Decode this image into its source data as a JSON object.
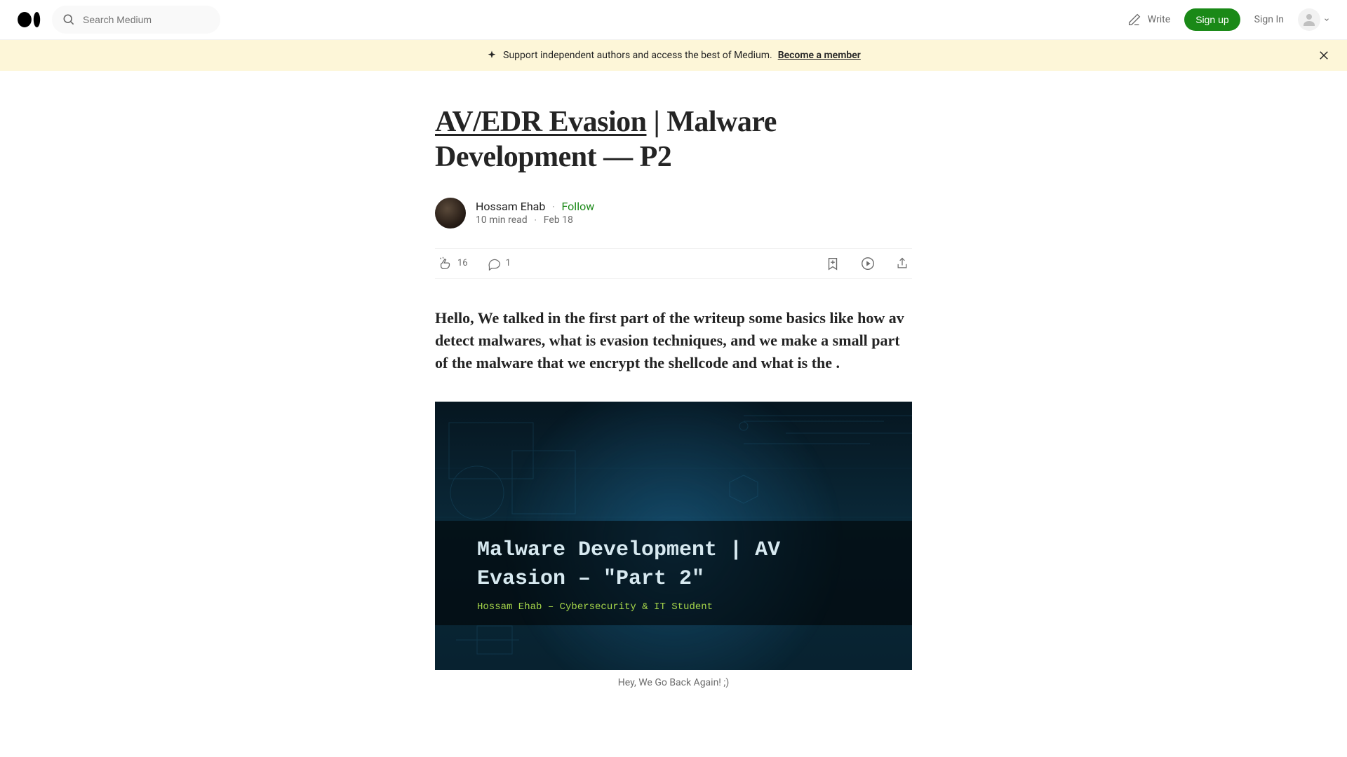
{
  "header": {
    "search_placeholder": "Search Medium",
    "write_label": "Write",
    "signup_label": "Sign up",
    "signin_label": "Sign In"
  },
  "banner": {
    "text": "Support independent authors and access the best of Medium.",
    "cta": "Become a member"
  },
  "article": {
    "title_underlined": "AV/EDR Evasion",
    "title_rest": " | Malware Development — P2",
    "author_name": "Hossam Ehab",
    "follow_label": "Follow",
    "read_time": "10 min read",
    "date": "Feb 18",
    "claps": "16",
    "responses": "1",
    "intro": "Hello, We talked in the first part of the writeup some basics like how av detect malwares, what is evasion techniques, and we make a small part of the malware that we encrypt the shellcode and what is the .",
    "hero_title_line1": "Malware Development | AV",
    "hero_title_line2": "Evasion – \"Part 2\"",
    "hero_sub": "Hossam Ehab – Cybersecurity & IT Student",
    "caption": "Hey, We Go Back Again! ;)"
  }
}
